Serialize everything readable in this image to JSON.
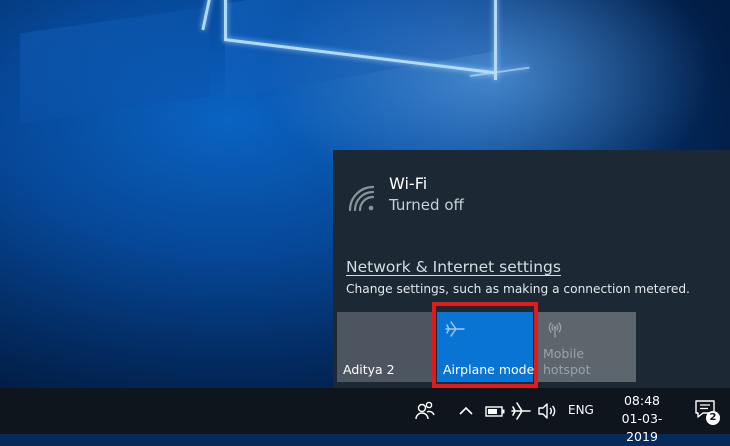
{
  "network_flyout": {
    "wifi": {
      "icon": "wifi-icon",
      "title": "Wi-Fi",
      "status": "Turned off"
    },
    "settings_link": "Network & Internet settings",
    "settings_description": "Change settings, such as making a connection metered."
  },
  "quick_actions": [
    {
      "label": "Aditya 2",
      "icon": "",
      "state": "off"
    },
    {
      "label": "Airplane mode",
      "icon": "airplane-icon",
      "state": "on"
    },
    {
      "label": "Mobile hotspot",
      "icon": "hotspot-icon",
      "state": "disabled"
    }
  ],
  "taskbar": {
    "language": "ENG",
    "time": "08:48",
    "date": "01-03-2019",
    "notification_count": "2",
    "icons": [
      "people-icon",
      "chevron-up-icon",
      "battery-icon",
      "airplane-icon",
      "volume-icon",
      "action-center-icon"
    ]
  },
  "colors": {
    "flyout_bg": "#1c2833",
    "tile_bg": "#4d5660",
    "accent": "#0a74d4",
    "highlight": "#e11a1a",
    "taskbar_bg": "#0e151d"
  }
}
